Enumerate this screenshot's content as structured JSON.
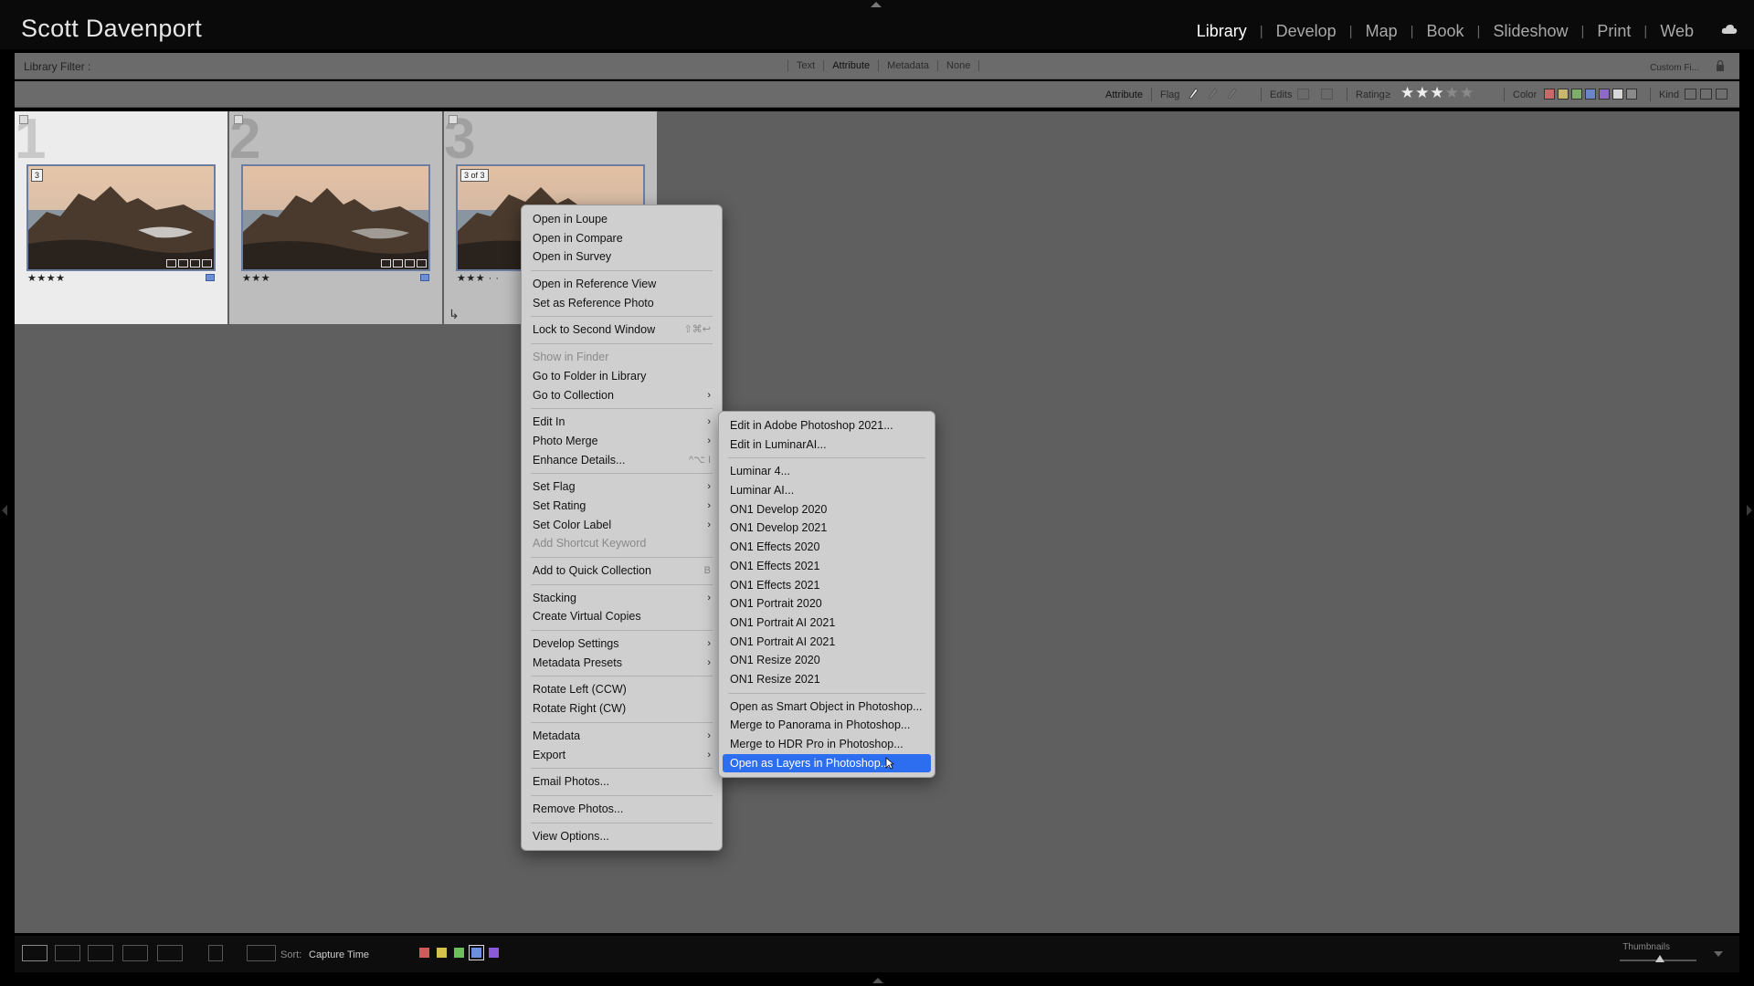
{
  "identity": {
    "name": "Scott Davenport"
  },
  "modules": [
    {
      "label": "Library",
      "active": true
    },
    {
      "label": "Develop",
      "active": false
    },
    {
      "label": "Map",
      "active": false
    },
    {
      "label": "Book",
      "active": false
    },
    {
      "label": "Slideshow",
      "active": false
    },
    {
      "label": "Print",
      "active": false
    },
    {
      "label": "Web",
      "active": false
    }
  ],
  "filter_bar": {
    "label": "Library Filter :",
    "tabs": [
      "Text",
      "Attribute",
      "Metadata",
      "None"
    ],
    "active_tab": "Attribute",
    "custom_filter": "Custom Fi..."
  },
  "attribute_bar": {
    "attribute": "Attribute",
    "flag": "Flag",
    "edits": "Edits",
    "rating": "Rating",
    "rating_op": "≥",
    "rating_stars": 3,
    "color": "Color",
    "kind": "Kind",
    "colors": [
      "#c96a6a",
      "#c8b86a",
      "#7fae6a",
      "#6a86c8",
      "#8e6ac8",
      "#d8d8d8",
      "#8a8a8a"
    ]
  },
  "grid": {
    "cells": [
      {
        "index": "1",
        "badge": "3",
        "rating": "★★★★"
      },
      {
        "index": "2",
        "badge": "",
        "rating": "★★★"
      },
      {
        "index": "3",
        "badge": "3 of 3",
        "rating": "★★★ · ·"
      }
    ]
  },
  "context_menu": {
    "groups": [
      [
        {
          "label": "Open in Loupe"
        },
        {
          "label": "Open in Compare"
        },
        {
          "label": "Open in Survey"
        }
      ],
      [
        {
          "label": "Open in Reference View"
        },
        {
          "label": "Set as Reference Photo"
        }
      ],
      [
        {
          "label": "Lock to Second Window",
          "shortcut": "⇧⌘↩"
        }
      ],
      [
        {
          "label": "Show in Finder",
          "disabled": true
        },
        {
          "label": "Go to Folder in Library"
        },
        {
          "label": "Go to Collection",
          "submenu": true
        }
      ],
      [
        {
          "label": "Edit In",
          "submenu": true
        },
        {
          "label": "Photo Merge",
          "submenu": true
        },
        {
          "label": "Enhance Details...",
          "shortcut": "^⌥ I"
        }
      ],
      [
        {
          "label": "Set Flag",
          "submenu": true
        },
        {
          "label": "Set Rating",
          "submenu": true
        },
        {
          "label": "Set Color Label",
          "submenu": true
        },
        {
          "label": "Add Shortcut Keyword",
          "disabled": true
        }
      ],
      [
        {
          "label": "Add to Quick Collection",
          "shortcut": "B"
        }
      ],
      [
        {
          "label": "Stacking",
          "submenu": true
        },
        {
          "label": "Create Virtual Copies"
        }
      ],
      [
        {
          "label": "Develop Settings",
          "submenu": true
        },
        {
          "label": "Metadata Presets",
          "submenu": true
        }
      ],
      [
        {
          "label": "Rotate Left (CCW)"
        },
        {
          "label": "Rotate Right (CW)"
        }
      ],
      [
        {
          "label": "Metadata",
          "submenu": true
        },
        {
          "label": "Export",
          "submenu": true
        }
      ],
      [
        {
          "label": "Email Photos..."
        }
      ],
      [
        {
          "label": "Remove Photos..."
        }
      ],
      [
        {
          "label": "View Options..."
        }
      ]
    ]
  },
  "edit_in_submenu": {
    "groups": [
      [
        {
          "label": "Edit in Adobe Photoshop 2021..."
        },
        {
          "label": "Edit in LuminarAI..."
        }
      ],
      [
        {
          "label": "Luminar 4..."
        },
        {
          "label": "Luminar AI..."
        },
        {
          "label": "ON1 Develop 2020"
        },
        {
          "label": "ON1 Develop 2021"
        },
        {
          "label": "ON1 Effects 2020"
        },
        {
          "label": "ON1 Effects 2021"
        },
        {
          "label": "ON1 Effects 2021"
        },
        {
          "label": "ON1 Portrait 2020"
        },
        {
          "label": "ON1 Portrait AI 2021"
        },
        {
          "label": "ON1 Portrait AI 2021"
        },
        {
          "label": "ON1 Resize 2020"
        },
        {
          "label": "ON1 Resize 2021"
        }
      ],
      [
        {
          "label": "Open as Smart Object in Photoshop..."
        },
        {
          "label": "Merge to Panorama in Photoshop..."
        },
        {
          "label": "Merge to HDR Pro in Photoshop..."
        },
        {
          "label": "Open as Layers in Photoshop...",
          "highlight": true
        }
      ]
    ]
  },
  "toolbar": {
    "sort_label": "Sort:",
    "sort_value": "Capture Time",
    "label_colors": [
      "#d05a5a",
      "#d4c24a",
      "#6abf5a",
      "#6a8fe0",
      "#8a5ad8"
    ],
    "thumbnails_label": "Thumbnails"
  }
}
